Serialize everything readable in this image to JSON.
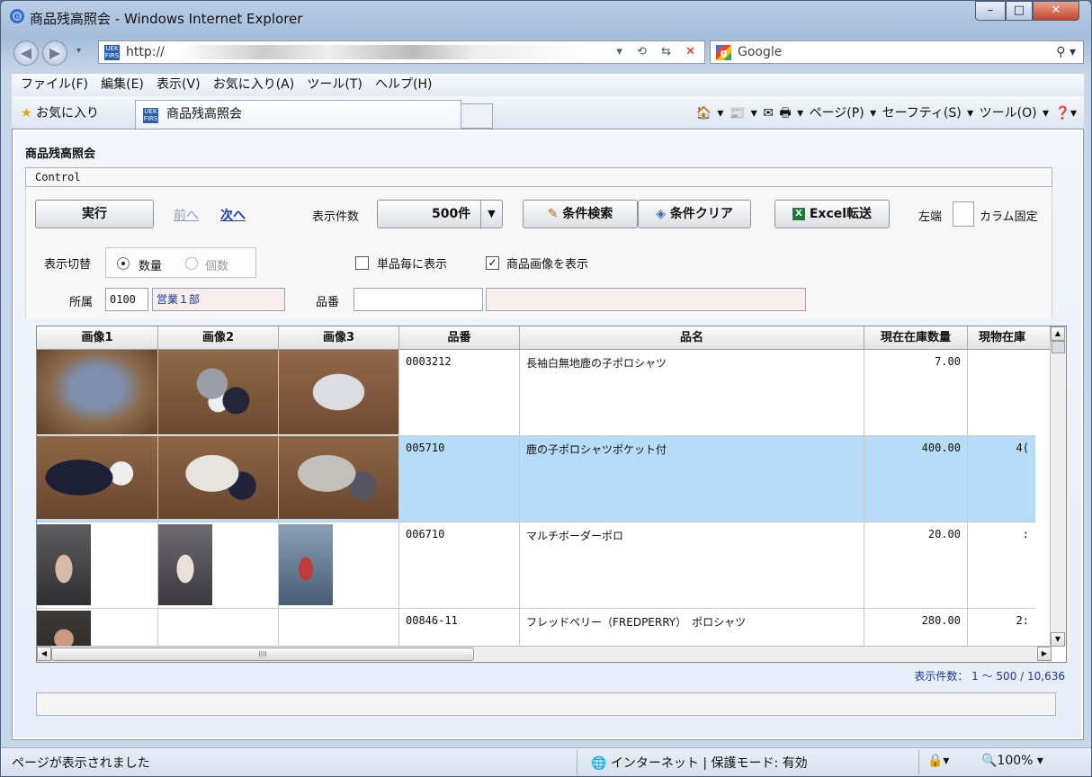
{
  "window": {
    "title": "商品残高照会 - Windows Internet Explorer",
    "min": "–",
    "max": "□",
    "close": "✕"
  },
  "address": {
    "url": "http://",
    "search_placeholder": "Google"
  },
  "menu": [
    "ファイル(F)",
    "編集(E)",
    "表示(V)",
    "お気に入り(A)",
    "ツール(T)",
    "ヘルプ(H)"
  ],
  "favbar": {
    "favorites": "お気に入り",
    "tab": "商品残高照会",
    "commands": "🏠 ▾  📰 ▾ ✉ 🖶 ▾ ページ(P) ▾  セーフティ(S) ▾  ツール(O) ▾  ❓▾"
  },
  "page": {
    "title": "商品残高照会",
    "control": "Control",
    "run": "実行",
    "prev": "前へ",
    "next": "次へ",
    "count_label": "表示件数",
    "count_value": "500件",
    "search": "条件検索",
    "clear": "条件クリア",
    "excel": "Excel転送",
    "left_label": "左端",
    "col_fix": "カラム固定",
    "toggle_label": "表示切替",
    "qty": "数量",
    "pieces": "個数",
    "per_item": "単品毎に表示",
    "show_image": "商品画像を表示",
    "dept_label": "所属",
    "dept_code": "0100",
    "dept_name": "営業１部",
    "code_label": "品番"
  },
  "grid": {
    "headers": [
      "画像1",
      "画像2",
      "画像3",
      "品番",
      "品名",
      "現在在庫数量",
      "現物在庫"
    ],
    "rows": [
      {
        "code": "0003212",
        "name": "長袖白無地鹿の子ポロシャツ",
        "qty": "7.00",
        "phys": ""
      },
      {
        "code": "005710",
        "name": "鹿の子ポロシャツポケット付",
        "qty": "400.00",
        "phys": "4("
      },
      {
        "code": "006710",
        "name": "マルチボーダーポロ",
        "qty": "20.00",
        "phys": ":"
      },
      {
        "code": "00846-11",
        "name": "フレッドペリー（FREDPERRY）　ポロシャツ",
        "qty": "280.00",
        "phys": "2:"
      }
    ],
    "scroll_mid": "IIII"
  },
  "record_count": "表示件数： 1 ～ 500 / 10,636",
  "status": {
    "message": "ページが表示されました",
    "zone": "🌐 インターネット | 保護モード: 有効",
    "zoom": "🔍100%  ▾",
    "security": "🔒▾"
  }
}
